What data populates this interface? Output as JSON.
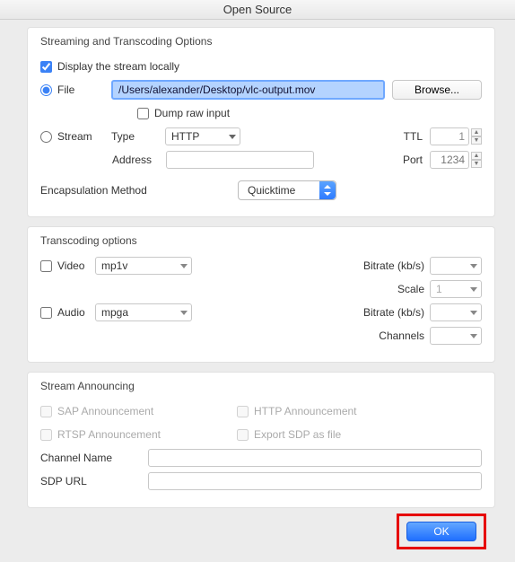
{
  "window": {
    "title": "Open Source"
  },
  "streaming": {
    "group_title": "Streaming and Transcoding Options",
    "display_locally_label": "Display the stream locally",
    "file_label": "File",
    "file_path": "/Users/alexander/Desktop/vlc-output.mov",
    "browse_label": "Browse...",
    "dump_raw_label": "Dump raw input",
    "stream_label": "Stream",
    "type_label": "Type",
    "type_value": "HTTP",
    "ttl_label": "TTL",
    "ttl_value": "1",
    "address_label": "Address",
    "address_value": "",
    "port_label": "Port",
    "port_placeholder": "1234",
    "encaps_label": "Encapsulation Method",
    "encaps_value": "Quicktime"
  },
  "transcoding": {
    "group_title": "Transcoding options",
    "video_label": "Video",
    "video_codec": "mp1v",
    "video_bitrate_label": "Bitrate (kb/s)",
    "scale_label": "Scale",
    "scale_value": "1",
    "audio_label": "Audio",
    "audio_codec": "mpga",
    "audio_bitrate_label": "Bitrate (kb/s)",
    "channels_label": "Channels"
  },
  "announcing": {
    "group_title": "Stream Announcing",
    "sap_label": "SAP Announcement",
    "http_label": "HTTP Announcement",
    "rtsp_label": "RTSP Announcement",
    "export_label": "Export SDP as file",
    "channel_name_label": "Channel Name",
    "sdp_url_label": "SDP URL"
  },
  "buttons": {
    "ok": "OK"
  }
}
